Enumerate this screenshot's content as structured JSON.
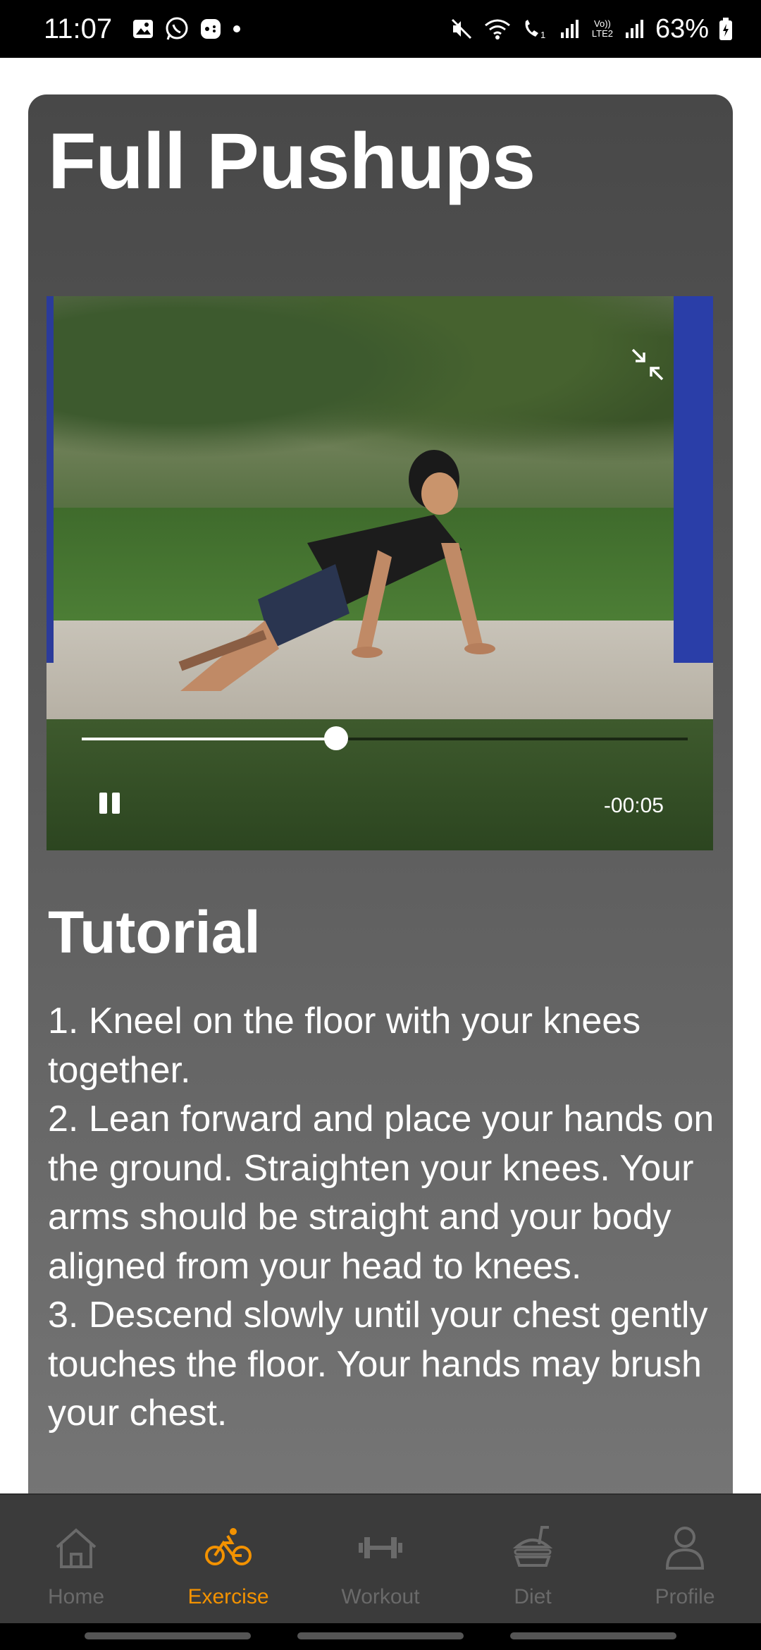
{
  "status_bar": {
    "time": "11:07",
    "battery": "63%",
    "left_icons": [
      "gallery-icon",
      "whatsapp-icon",
      "game-icon",
      "dot-icon"
    ],
    "right_icons": [
      "mute-icon",
      "wifi-icon",
      "wifi-calling-icon",
      "signal-icon",
      "volte-icon",
      "signal-icon",
      "battery-icon"
    ],
    "volte_label": "Vo)) LTE2"
  },
  "exercise": {
    "title": "Full Pushups"
  },
  "video": {
    "progress": 0.42,
    "time_remaining": "-00:05"
  },
  "tutorial": {
    "heading": "Tutorial",
    "steps": [
      "1. Kneel on the floor with your knees together.",
      "2. Lean forward and place your hands on the ground. Straighten your knees. Your arms should be straight and your body aligned from your head to knees.",
      "3. Descend slowly until your chest gently touches the floor. Your hands may brush your chest."
    ]
  },
  "bottom_nav": {
    "items": [
      {
        "label": "Home",
        "icon": "home-icon",
        "active": false
      },
      {
        "label": "Exercise",
        "icon": "bicycle-icon",
        "active": true
      },
      {
        "label": "Workout",
        "icon": "dumbbell-icon",
        "active": false
      },
      {
        "label": "Diet",
        "icon": "food-icon",
        "active": false
      },
      {
        "label": "Profile",
        "icon": "profile-icon",
        "active": false
      }
    ],
    "accent_color": "#f39200",
    "inactive_color": "#6a6a6a"
  }
}
